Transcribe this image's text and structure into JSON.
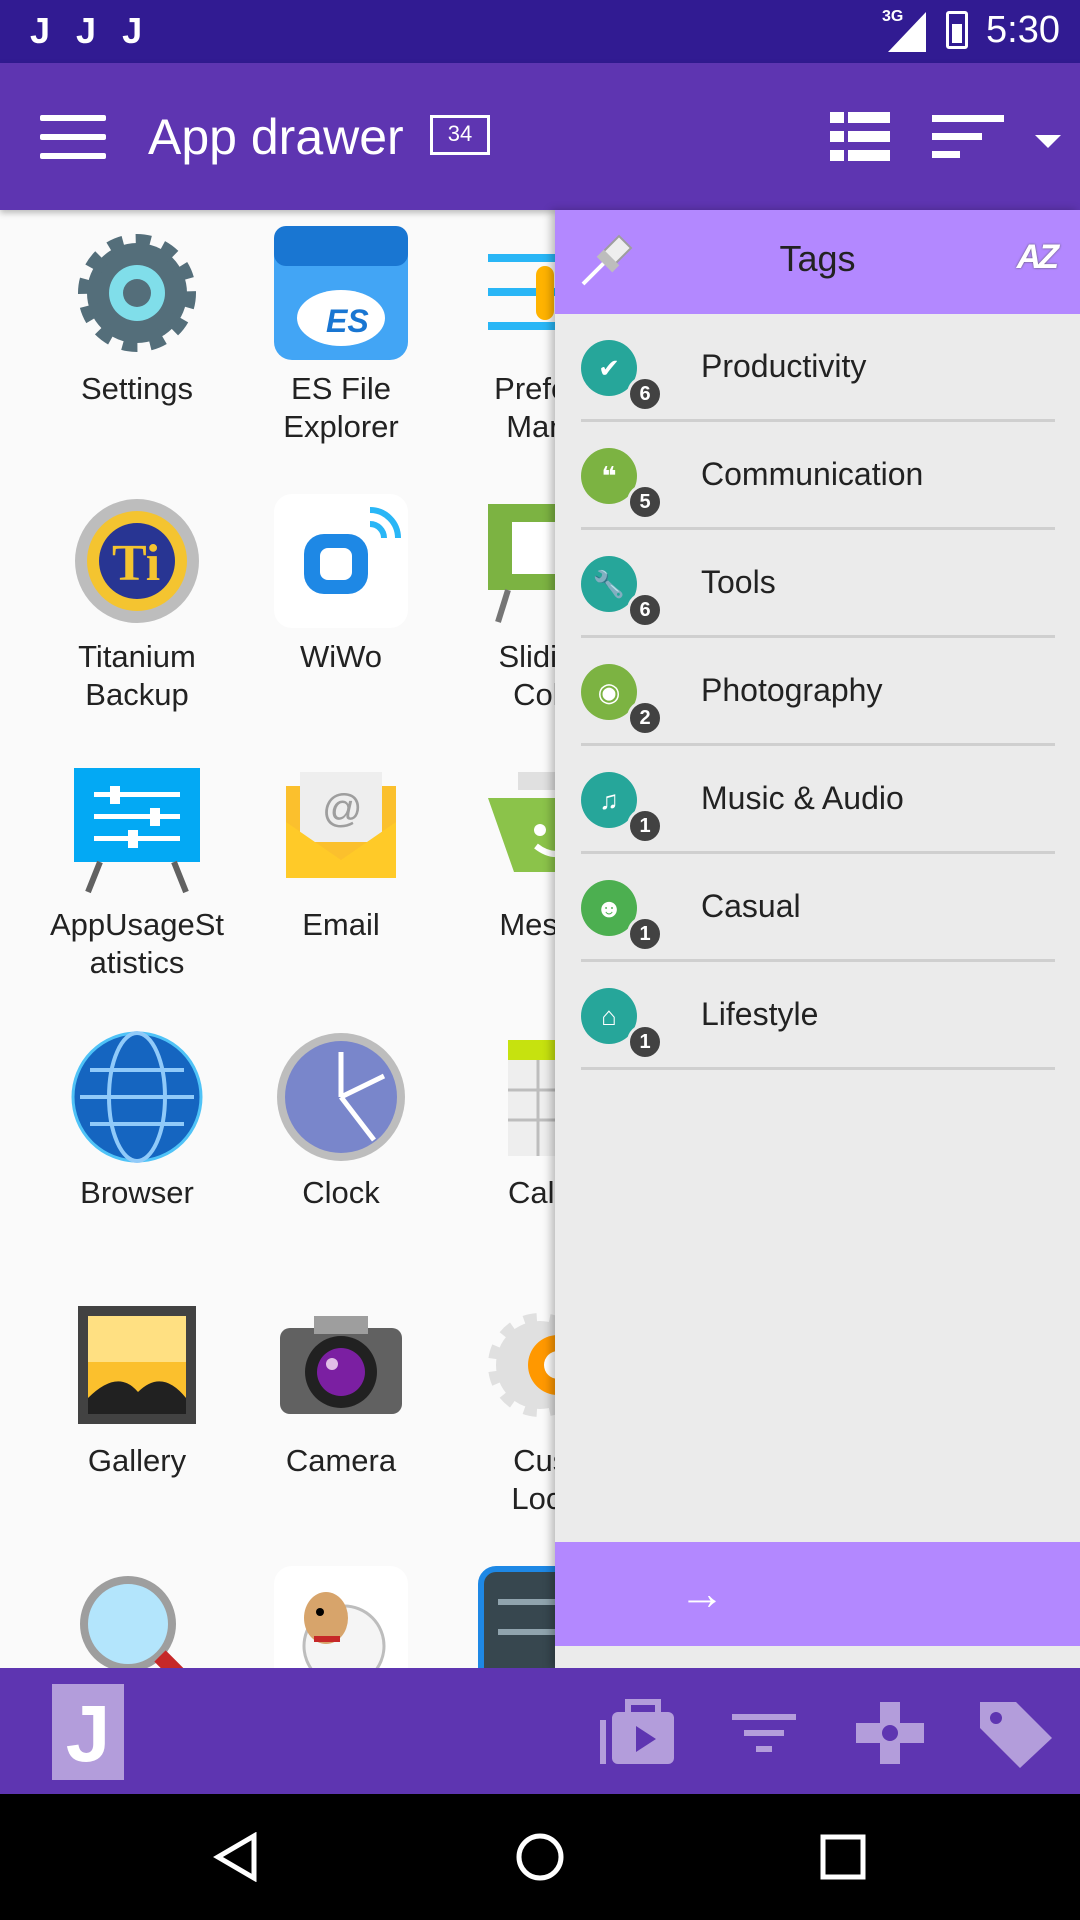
{
  "status_bar": {
    "left_icons": [
      "J",
      "J",
      "J"
    ],
    "network": "3G",
    "time": "5:30"
  },
  "toolbar": {
    "title": "App drawer",
    "count": "34"
  },
  "apps": [
    {
      "label": "Settings",
      "icon": "settings-gear-icon",
      "color": "#546e7a"
    },
    {
      "label": "ES File\nExplorer",
      "icon": "folder-cloud-icon",
      "color": "#2196f3"
    },
    {
      "label": "Prefere\nMana",
      "icon": "sliders-icon",
      "color": "#29b6f6"
    },
    {
      "label": "Titanium\nBackup",
      "icon": "titanium-icon",
      "color": "#f4c430"
    },
    {
      "label": "WiWo",
      "icon": "wiwo-icon",
      "color": "#1e88e5"
    },
    {
      "label": "Sliding\nColo",
      "icon": "presentation-icon",
      "color": "#7cb342"
    },
    {
      "label": "AppUsageSt\natistics",
      "icon": "presentation-sliders-icon",
      "color": "#03a9f4"
    },
    {
      "label": "Email",
      "icon": "envelope-icon",
      "color": "#fbc02d"
    },
    {
      "label": "Messa",
      "icon": "message-icon",
      "color": "#8bc34a"
    },
    {
      "label": "Browser",
      "icon": "globe-icon",
      "color": "#1565c0"
    },
    {
      "label": "Clock",
      "icon": "clock-icon",
      "color": "#7986cb"
    },
    {
      "label": "Caler",
      "icon": "calendar-icon",
      "color": "#c6e20f"
    },
    {
      "label": "Gallery",
      "icon": "picture-icon",
      "color": "#fbc02d"
    },
    {
      "label": "Camera",
      "icon": "camera-icon",
      "color": "#616161"
    },
    {
      "label": "Cust\nLoca",
      "icon": "gear-orange-icon",
      "color": "#ff9800"
    },
    {
      "label": "",
      "icon": "magnifier-icon",
      "color": "#4fc3f7"
    },
    {
      "label": "",
      "icon": "sheep-icon",
      "color": "#a1887f"
    },
    {
      "label": "",
      "icon": "settings-board-icon",
      "color": "#1e88e5"
    }
  ],
  "tags_panel": {
    "title": "Tags",
    "sort_label": "AZ",
    "items": [
      {
        "label": "Productivity",
        "count": "6",
        "icon": "check-circle-icon",
        "color": "#26a69a",
        "glyph": "✔"
      },
      {
        "label": "Communication",
        "count": "5",
        "icon": "chat-icon",
        "color": "#7cb342",
        "glyph": "❝"
      },
      {
        "label": "Tools",
        "count": "6",
        "icon": "wrench-icon",
        "color": "#26a69a",
        "glyph": "🔧"
      },
      {
        "label": "Photography",
        "count": "2",
        "icon": "camera-icon",
        "color": "#7cb342",
        "glyph": "◉"
      },
      {
        "label": "Music & Audio",
        "count": "1",
        "icon": "music-note-icon",
        "color": "#26a69a",
        "glyph": "♫"
      },
      {
        "label": "Casual",
        "count": "1",
        "icon": "game-face-icon",
        "color": "#4caf50",
        "glyph": "☻"
      },
      {
        "label": "Lifestyle",
        "count": "1",
        "icon": "home-icon",
        "color": "#26a69a",
        "glyph": "⌂"
      }
    ],
    "go_icon": "→"
  },
  "bottom_bar": {
    "logo_text": "J"
  }
}
